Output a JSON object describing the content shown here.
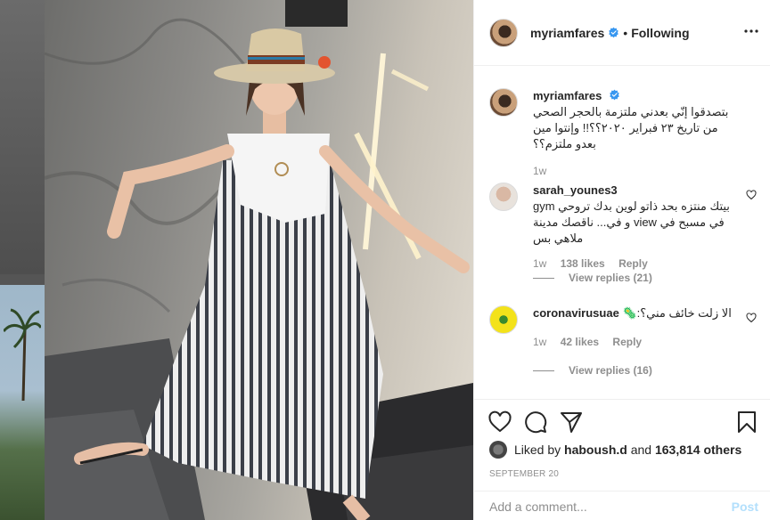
{
  "post": {
    "username": "myriamfares",
    "follow_state": "Following",
    "separator": "•"
  },
  "caption": {
    "username": "myriamfares",
    "text": "بتصدقوا إنّي بعدني ملتزمة بالحجر الصحي من تاريخ ٢٣ فبراير ٢٠٢٠؟؟!! وإنتوا مين بعدو ملتزم؟؟",
    "time": "1w"
  },
  "comments": [
    {
      "username": "sarah_younes3",
      "text": "بيتك منتزه بحد ذاتو لوين بدك تروحي gym في مسبح في view و في... ناقصك مدينة ملاهي بس",
      "time": "1w",
      "likes": "138 likes",
      "reply": "Reply",
      "view_replies": "View replies (21)"
    },
    {
      "username": "coronavirusuae",
      "text": "الا زلت خائف مني؟:🦠",
      "time": "1w",
      "likes": "42 likes",
      "reply": "Reply",
      "view_replies": "View replies (16)"
    }
  ],
  "likes": {
    "prefix": "Liked by",
    "user": "haboush.d",
    "middle": "and",
    "others": "163,814 others"
  },
  "date": "SEPTEMBER 20",
  "add_comment": {
    "placeholder": "Add a comment...",
    "post_label": "Post"
  },
  "icons": {
    "more": "more-options-icon",
    "like": "heart-icon",
    "comment": "comment-icon",
    "share": "share-icon",
    "save": "bookmark-icon",
    "verified": "verified-badge-icon"
  },
  "colors": {
    "verified": "#3897f0",
    "post_disabled": "#b2dffc",
    "muted": "#8e8e8e"
  }
}
